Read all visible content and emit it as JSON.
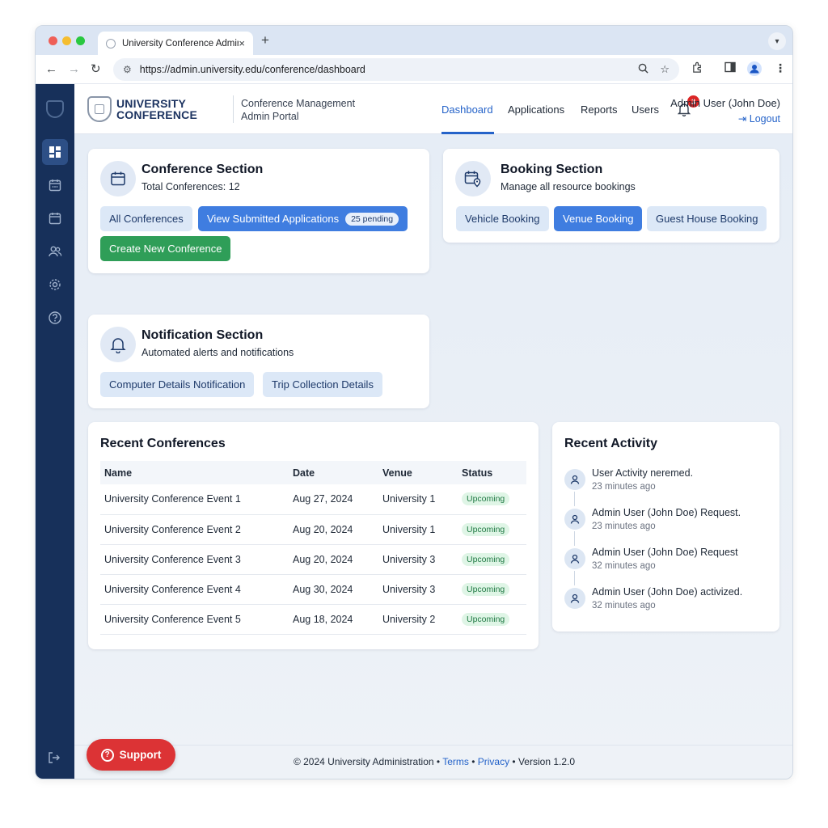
{
  "browser": {
    "tab_title": "University Conference Admin",
    "tab_close": "×",
    "new_tab": "+",
    "url": "https://admin.university.edu/conference/dashboard"
  },
  "header": {
    "brand_line1": "UNIVERSITY",
    "brand_line2": "CONFERENCE",
    "portal_line1": "Conference Management",
    "portal_line2": "Admin Portal",
    "nav": [
      "Dashboard",
      "Applications",
      "Reports",
      "Users"
    ],
    "notification_count": "3",
    "user_name": "Admin User (John Doe)",
    "logout_label": "Logout"
  },
  "conference_section": {
    "title": "Conference Section",
    "subtitle": "Total Conferences: 12",
    "all_button": "All Conferences",
    "submitted_button": "View Submitted Applications",
    "pending_badge": "25 pending",
    "create_button": "Create New Conference"
  },
  "booking_section": {
    "title": "Booking Section",
    "subtitle": "Manage all resource bookings",
    "vehicle_button": "Vehicle Booking",
    "venue_button": "Venue Booking",
    "guesthouse_button": "Guest House Booking"
  },
  "notification_section": {
    "title": "Notification Section",
    "subtitle": "Automated alerts and notifications",
    "computer_button": "Computer Details Notification",
    "trip_button": "Trip Collection Details"
  },
  "recent_conferences": {
    "title": "Recent Conferences",
    "columns": [
      "Name",
      "Date",
      "Venue",
      "Status"
    ],
    "rows": [
      [
        "University Conference Event 1",
        "Aug 27, 2024",
        "University 1",
        "Upcoming"
      ],
      [
        "University Conference Event 2",
        "Aug 20, 2024",
        "University 1",
        "Upcoming"
      ],
      [
        "University Conference Event 3",
        "Aug 20, 2024",
        "University 3",
        "Upcoming"
      ],
      [
        "University Conference Event 4",
        "Aug 30, 2024",
        "University 3",
        "Upcoming"
      ],
      [
        "University Conference Event 5",
        "Aug 18, 2024",
        "University 2",
        "Upcoming"
      ]
    ]
  },
  "recent_activity": {
    "title": "Recent Activity",
    "items": [
      {
        "text": "User Activity neremed.",
        "time": "23 minutes ago"
      },
      {
        "text": "Admin User (John Doe) Request.",
        "time": "23 minutes ago"
      },
      {
        "text": "Admin User (John Doe) Request",
        "time": "32 minutes ago"
      },
      {
        "text": "Admin User (John Doe) activized.",
        "time": "32 minutes ago"
      }
    ]
  },
  "footer": {
    "copyright": "© 2024 University Administration",
    "sep": " • ",
    "terms": "Terms",
    "privacy": "Privacy",
    "version": "Version 1.2.0"
  },
  "support_label": "Support",
  "colors": {
    "sidebar": "#17305a",
    "accent": "#2563c9",
    "primary_button": "#3f7de0",
    "create_button": "#2f9e58",
    "support_button": "#dc3335",
    "badge": "#dc2626"
  }
}
